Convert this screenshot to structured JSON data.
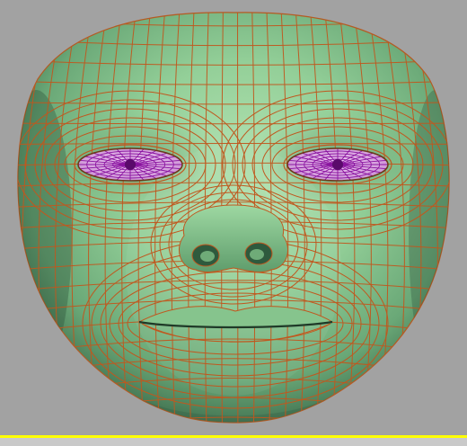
{
  "viewport": {
    "background": "#a2a2a2",
    "active_border_color": "#ffff00",
    "model": {
      "subject": "face-mesh",
      "skin_color": "#8fcb96",
      "wire_color": "#c0581f",
      "eye_color": "#e4b3ea",
      "eye_wire_color": "#8a14a0"
    }
  }
}
